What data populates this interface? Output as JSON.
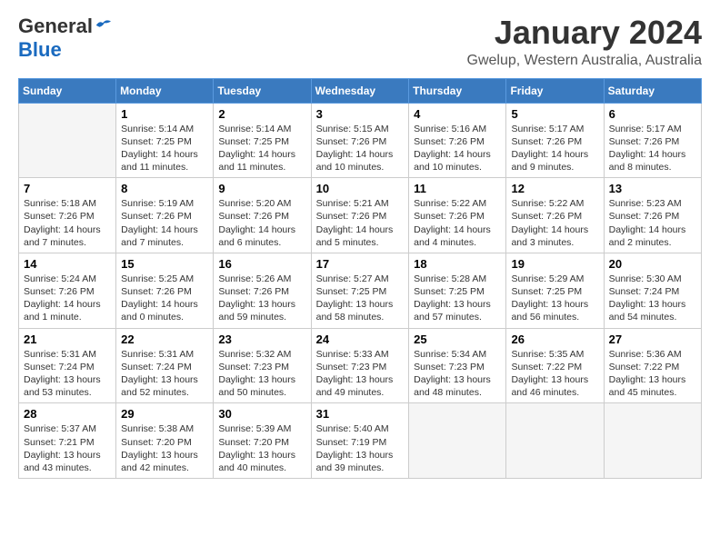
{
  "logo": {
    "general": "General",
    "blue": "Blue"
  },
  "header": {
    "month": "January 2024",
    "location": "Gwelup, Western Australia, Australia"
  },
  "days_of_week": [
    "Sunday",
    "Monday",
    "Tuesday",
    "Wednesday",
    "Thursday",
    "Friday",
    "Saturday"
  ],
  "weeks": [
    [
      {
        "day": "",
        "info": ""
      },
      {
        "day": "1",
        "info": "Sunrise: 5:14 AM\nSunset: 7:25 PM\nDaylight: 14 hours\nand 11 minutes."
      },
      {
        "day": "2",
        "info": "Sunrise: 5:14 AM\nSunset: 7:25 PM\nDaylight: 14 hours\nand 11 minutes."
      },
      {
        "day": "3",
        "info": "Sunrise: 5:15 AM\nSunset: 7:26 PM\nDaylight: 14 hours\nand 10 minutes."
      },
      {
        "day": "4",
        "info": "Sunrise: 5:16 AM\nSunset: 7:26 PM\nDaylight: 14 hours\nand 10 minutes."
      },
      {
        "day": "5",
        "info": "Sunrise: 5:17 AM\nSunset: 7:26 PM\nDaylight: 14 hours\nand 9 minutes."
      },
      {
        "day": "6",
        "info": "Sunrise: 5:17 AM\nSunset: 7:26 PM\nDaylight: 14 hours\nand 8 minutes."
      }
    ],
    [
      {
        "day": "7",
        "info": "Sunrise: 5:18 AM\nSunset: 7:26 PM\nDaylight: 14 hours\nand 7 minutes."
      },
      {
        "day": "8",
        "info": "Sunrise: 5:19 AM\nSunset: 7:26 PM\nDaylight: 14 hours\nand 7 minutes."
      },
      {
        "day": "9",
        "info": "Sunrise: 5:20 AM\nSunset: 7:26 PM\nDaylight: 14 hours\nand 6 minutes."
      },
      {
        "day": "10",
        "info": "Sunrise: 5:21 AM\nSunset: 7:26 PM\nDaylight: 14 hours\nand 5 minutes."
      },
      {
        "day": "11",
        "info": "Sunrise: 5:22 AM\nSunset: 7:26 PM\nDaylight: 14 hours\nand 4 minutes."
      },
      {
        "day": "12",
        "info": "Sunrise: 5:22 AM\nSunset: 7:26 PM\nDaylight: 14 hours\nand 3 minutes."
      },
      {
        "day": "13",
        "info": "Sunrise: 5:23 AM\nSunset: 7:26 PM\nDaylight: 14 hours\nand 2 minutes."
      }
    ],
    [
      {
        "day": "14",
        "info": "Sunrise: 5:24 AM\nSunset: 7:26 PM\nDaylight: 14 hours\nand 1 minute."
      },
      {
        "day": "15",
        "info": "Sunrise: 5:25 AM\nSunset: 7:26 PM\nDaylight: 14 hours\nand 0 minutes."
      },
      {
        "day": "16",
        "info": "Sunrise: 5:26 AM\nSunset: 7:26 PM\nDaylight: 13 hours\nand 59 minutes."
      },
      {
        "day": "17",
        "info": "Sunrise: 5:27 AM\nSunset: 7:25 PM\nDaylight: 13 hours\nand 58 minutes."
      },
      {
        "day": "18",
        "info": "Sunrise: 5:28 AM\nSunset: 7:25 PM\nDaylight: 13 hours\nand 57 minutes."
      },
      {
        "day": "19",
        "info": "Sunrise: 5:29 AM\nSunset: 7:25 PM\nDaylight: 13 hours\nand 56 minutes."
      },
      {
        "day": "20",
        "info": "Sunrise: 5:30 AM\nSunset: 7:24 PM\nDaylight: 13 hours\nand 54 minutes."
      }
    ],
    [
      {
        "day": "21",
        "info": "Sunrise: 5:31 AM\nSunset: 7:24 PM\nDaylight: 13 hours\nand 53 minutes."
      },
      {
        "day": "22",
        "info": "Sunrise: 5:31 AM\nSunset: 7:24 PM\nDaylight: 13 hours\nand 52 minutes."
      },
      {
        "day": "23",
        "info": "Sunrise: 5:32 AM\nSunset: 7:23 PM\nDaylight: 13 hours\nand 50 minutes."
      },
      {
        "day": "24",
        "info": "Sunrise: 5:33 AM\nSunset: 7:23 PM\nDaylight: 13 hours\nand 49 minutes."
      },
      {
        "day": "25",
        "info": "Sunrise: 5:34 AM\nSunset: 7:23 PM\nDaylight: 13 hours\nand 48 minutes."
      },
      {
        "day": "26",
        "info": "Sunrise: 5:35 AM\nSunset: 7:22 PM\nDaylight: 13 hours\nand 46 minutes."
      },
      {
        "day": "27",
        "info": "Sunrise: 5:36 AM\nSunset: 7:22 PM\nDaylight: 13 hours\nand 45 minutes."
      }
    ],
    [
      {
        "day": "28",
        "info": "Sunrise: 5:37 AM\nSunset: 7:21 PM\nDaylight: 13 hours\nand 43 minutes."
      },
      {
        "day": "29",
        "info": "Sunrise: 5:38 AM\nSunset: 7:20 PM\nDaylight: 13 hours\nand 42 minutes."
      },
      {
        "day": "30",
        "info": "Sunrise: 5:39 AM\nSunset: 7:20 PM\nDaylight: 13 hours\nand 40 minutes."
      },
      {
        "day": "31",
        "info": "Sunrise: 5:40 AM\nSunset: 7:19 PM\nDaylight: 13 hours\nand 39 minutes."
      },
      {
        "day": "",
        "info": ""
      },
      {
        "day": "",
        "info": ""
      },
      {
        "day": "",
        "info": ""
      }
    ]
  ]
}
